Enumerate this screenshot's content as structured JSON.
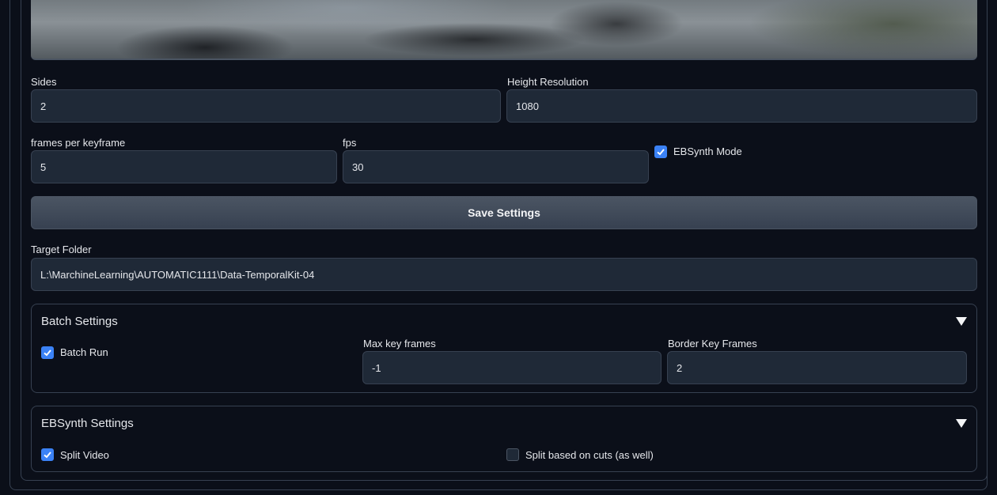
{
  "settings": {
    "sides_label": "Sides",
    "sides_value": "2",
    "height_label": "Height Resolution",
    "height_value": "1080",
    "fpk_label": "frames per keyframe",
    "fpk_value": "5",
    "fps_label": "fps",
    "fps_value": "30",
    "ebsynth_mode_label": "EBSynth Mode",
    "ebsynth_mode_checked": true,
    "save_label": "Save Settings",
    "target_folder_label": "Target Folder",
    "target_folder_value": "L:\\MarchineLearning\\AUTOMATIC1111\\Data-TemporalKit-04"
  },
  "batch": {
    "title": "Batch Settings",
    "batch_run_label": "Batch Run",
    "batch_run_checked": true,
    "max_key_frames_label": "Max key frames",
    "max_key_frames_value": "-1",
    "border_key_frames_label": "Border Key Frames",
    "border_key_frames_value": "2"
  },
  "ebsynth": {
    "title": "EBSynth Settings",
    "split_video_label": "Split Video",
    "split_video_checked": true,
    "split_cuts_label": "Split based on cuts (as well)",
    "split_cuts_checked": false
  },
  "colors": {
    "background": "#0b0f19",
    "field": "#1f2937",
    "accent": "#3b82f6",
    "border": "#374151"
  },
  "icons": [
    "check-icon",
    "collapse-triangle-icon"
  ]
}
